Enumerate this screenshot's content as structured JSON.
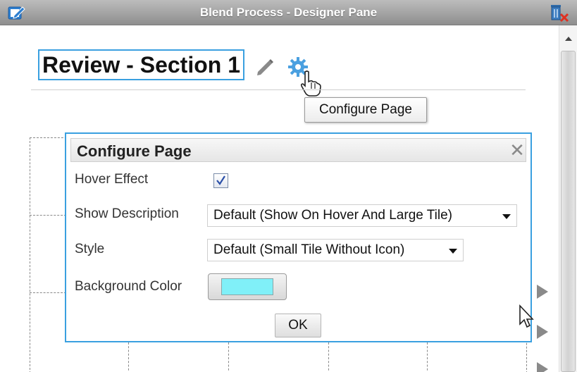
{
  "window": {
    "title": "Blend Process - Designer Pane"
  },
  "page": {
    "title": "Review - Section 1"
  },
  "tooltip": {
    "text": "Configure Page"
  },
  "dialog": {
    "title": "Configure Page",
    "close_glyph": "✕",
    "hover_effect": {
      "label": "Hover Effect",
      "checked": true,
      "check_glyph": "✓"
    },
    "show_description": {
      "label": "Show Description",
      "value": "Default (Show On Hover And Large Tile)"
    },
    "style": {
      "label": "Style",
      "value": "Default (Small Tile Without Icon)"
    },
    "background_color": {
      "label": "Background Color",
      "value": "#80f0f8"
    },
    "ok_label": "OK"
  },
  "colors": {
    "accent": "#3aa0e0",
    "titlebar": "#a0a0a0",
    "swatch": "#80f0f8"
  },
  "icons": [
    "edit-icon",
    "trash-delete-icon",
    "pencil-icon",
    "gear-icon",
    "hand-cursor-icon",
    "close-icon",
    "chevron-down-icon",
    "arrow-right-icon",
    "arrow-cursor-icon"
  ]
}
